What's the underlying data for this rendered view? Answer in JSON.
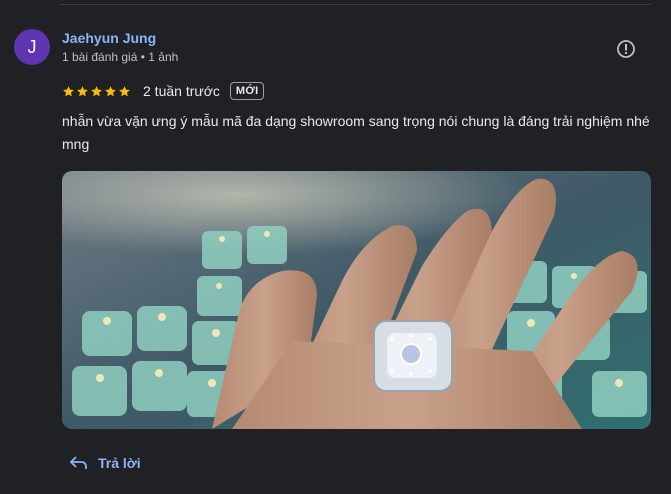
{
  "review": {
    "avatar_letter": "J",
    "avatar_color": "#5e35b1",
    "author": "Jaehyun Jung",
    "meta": "1 bài đánh giá • 1 ảnh",
    "rating": 5,
    "time": "2 tuần trước",
    "badge": "MỚI",
    "text": "nhẫn vừa vặn ưng ý mẫu mã đa dạng showroom sang trọng nói chung là đáng trải nghiệm nhé mng"
  },
  "actions": {
    "reply_label": "Trả lời",
    "report_icon": "report-flag-icon",
    "reply_icon": "reply-arrow-icon"
  },
  "colors": {
    "background": "#202124",
    "link": "#8ab4f8",
    "star": "#fbbc04"
  }
}
